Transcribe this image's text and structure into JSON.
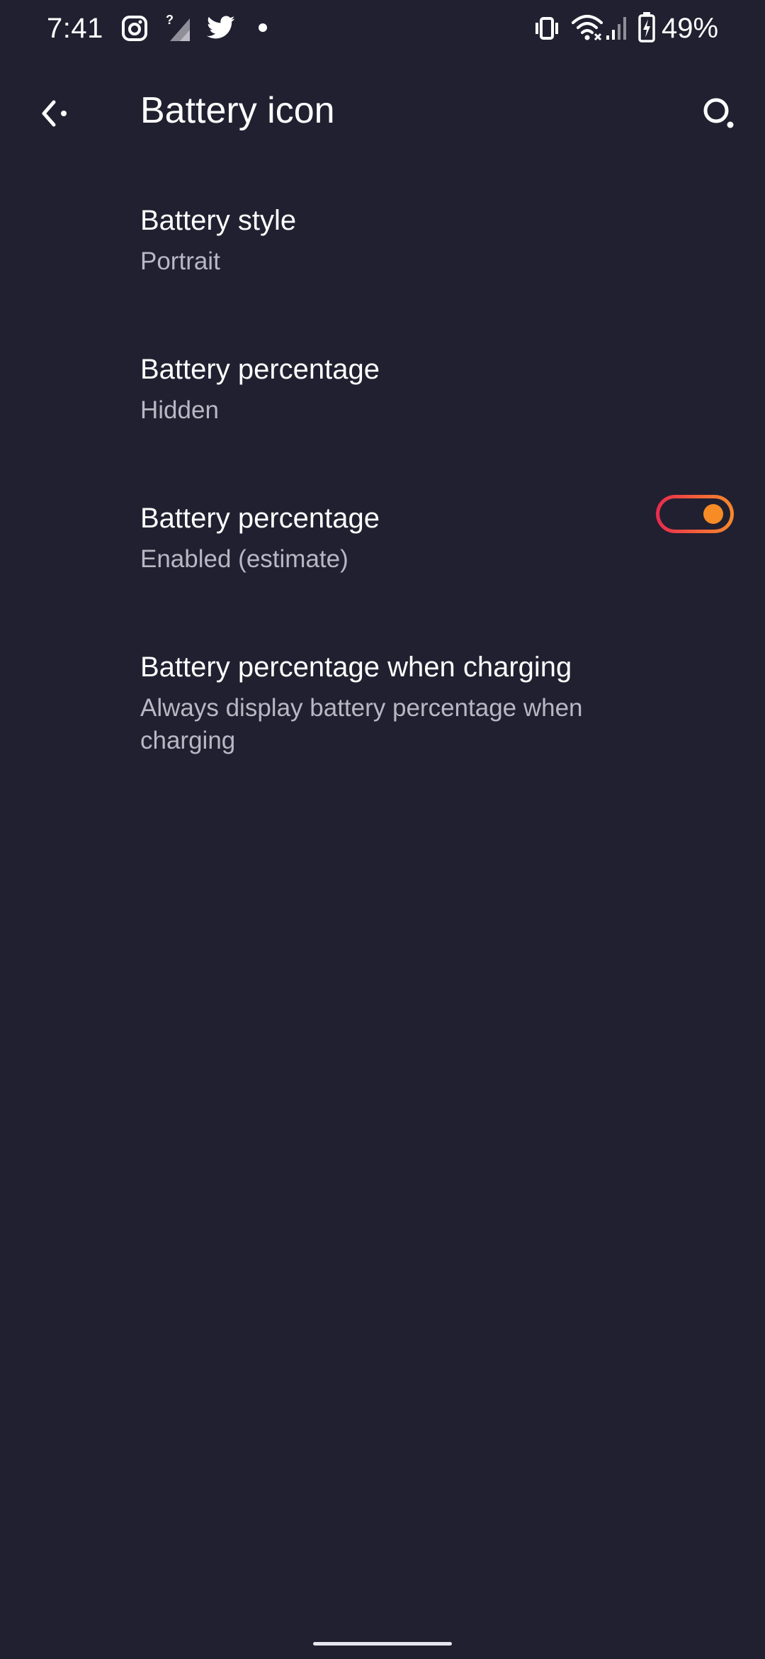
{
  "status_bar": {
    "time": "7:41",
    "battery_percent": "49%",
    "left_icons": [
      "photo-notification-icon",
      "no-sim-signal-icon",
      "twitter-icon",
      "notification-dot-icon"
    ],
    "right_icons": [
      "vibrate-icon",
      "wifi-icon",
      "cell-signal-icon",
      "battery-charging-icon"
    ]
  },
  "app_bar": {
    "title": "Battery icon",
    "back_icon": "back-arrow-icon",
    "search_icon": "search-icon"
  },
  "settings": [
    {
      "title": "Battery style",
      "summary": "Portrait"
    },
    {
      "title": "Battery percentage",
      "summary": "Hidden"
    },
    {
      "title": "Battery percentage",
      "summary": "Enabled (estimate)"
    },
    {
      "title": "Battery percentage when charging",
      "summary": "Always display battery percentage when charging",
      "toggle_on": true
    }
  ],
  "colors": {
    "background": "#212030",
    "primary_text": "#ffffff",
    "secondary_text": "#b8b7c3",
    "switch_gradient_start": "#e8294e",
    "switch_gradient_end": "#f7892b",
    "switch_thumb": "#f78b25"
  }
}
